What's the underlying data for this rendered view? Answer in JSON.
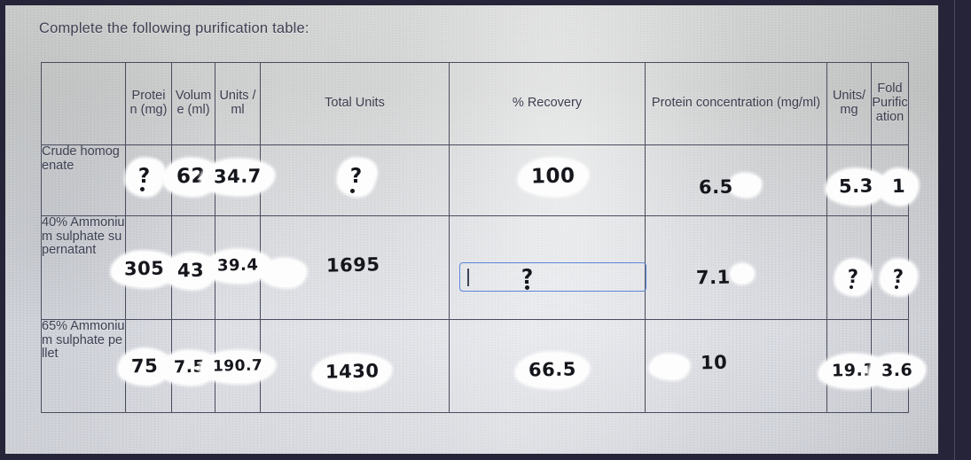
{
  "prompt": "Complete the following purification table:",
  "table": {
    "corner_header": "",
    "headers": [
      "Protein (mg)",
      "Volume (ml)",
      "Units / ml",
      "Total Units",
      "% Recovery",
      "Protein concentration (mg/ml)",
      "Units/ mg",
      "Fold Purification"
    ],
    "header_lines": {
      "protein": [
        "Protei",
        "n (mg)"
      ],
      "volume": [
        "Volum",
        "e (ml)"
      ],
      "units_per_ml": [
        "Units /",
        "ml"
      ],
      "total_units": [
        "Total Units"
      ],
      "recovery": [
        "% Recovery"
      ],
      "protein_conc": [
        "Protein concentration (mg/ml)"
      ],
      "units_per_mg": [
        "Units/",
        "mg"
      ],
      "fold": [
        "Fold",
        "Purific",
        "ation"
      ]
    },
    "rows": [
      {
        "label": "Crude homogenate",
        "protein_mg": "?",
        "volume_ml": "62",
        "units_per_ml": "34.7",
        "total_units": "?",
        "recovery": "100",
        "protein_conc": "6.5",
        "units_per_mg": "5.3",
        "fold": "1"
      },
      {
        "label": "40% Ammonium sulphate supernatant",
        "protein_mg": "305",
        "volume_ml": "43",
        "units_per_ml": "39.4",
        "total_units": "1695",
        "recovery": "?",
        "protein_conc": "7.1",
        "units_per_mg": "?",
        "fold": "?"
      },
      {
        "label": "65% Ammonium sulphate pellet",
        "protein_mg": "75",
        "volume_ml": "7.5",
        "units_per_ml": "190.7",
        "total_units": "1430",
        "recovery": "66.5",
        "protein_conc": "10",
        "units_per_mg": "19.1",
        "fold": "3.6"
      }
    ]
  },
  "active_field": {
    "value": "?",
    "row": "40% Ammonium sulphate supernatant",
    "column": "% Recovery",
    "border_color": "#5b86d6"
  },
  "colors": {
    "page_background": "#262438",
    "paper": "#d3d5d8",
    "ink": "#15161c",
    "printed_text": "#3c3d4f",
    "accent": "#5b86d6"
  }
}
